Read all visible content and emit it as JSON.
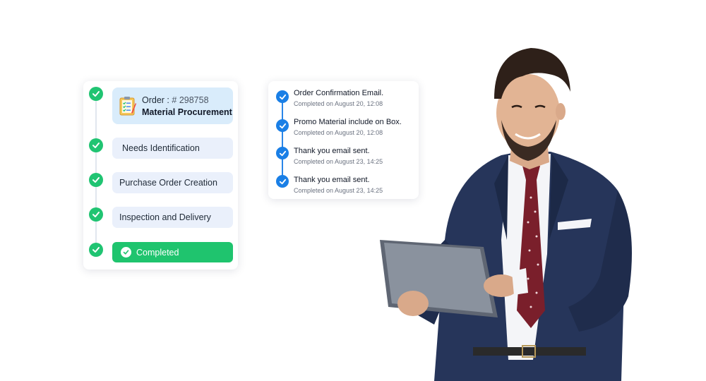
{
  "workflow": {
    "order_label": "Order :",
    "order_number": "# 298758",
    "order_title": "Material Procurement",
    "steps": [
      {
        "label": "Needs Identification"
      },
      {
        "label": "Purchase Order Creation"
      },
      {
        "label": "Inspection and Delivery"
      }
    ],
    "completed_label": "Completed"
  },
  "emails": {
    "items": [
      {
        "title": "Order Confirmation Email.",
        "status": "Completed on August 20, 12:08"
      },
      {
        "title": "Promo Material include on Box.",
        "status": "Completed on August 20, 12:08"
      },
      {
        "title": "Thank you email sent.",
        "status": "Completed on August 23, 14:25"
      },
      {
        "title": "Thank you email sent.",
        "status": "Completed on August 23, 14:25"
      }
    ]
  },
  "colors": {
    "success_green": "#20c472",
    "accent_blue": "#1a7fe6",
    "step_bg": "#eaf0fb",
    "order_bg": "#d9ecfb"
  },
  "icons": {
    "step_check": "check-circle-icon",
    "order": "clipboard-checklist-icon",
    "email_check": "check-circle-icon"
  }
}
